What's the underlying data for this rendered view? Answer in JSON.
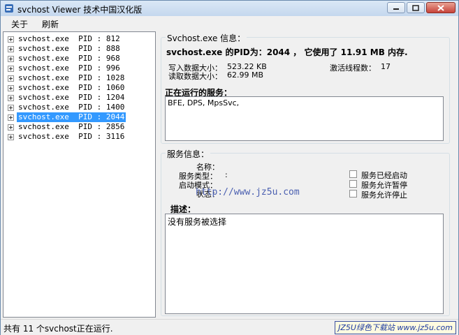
{
  "window": {
    "title": "svchost Viewer 技术中国汉化版"
  },
  "menu": {
    "items": [
      "关于",
      "刷新"
    ]
  },
  "tree": {
    "items": [
      {
        "name": "svchost.exe",
        "pid": "PID : 812",
        "selected": false
      },
      {
        "name": "svchost.exe",
        "pid": "PID : 888",
        "selected": false
      },
      {
        "name": "svchost.exe",
        "pid": "PID : 968",
        "selected": false
      },
      {
        "name": "svchost.exe",
        "pid": "PID : 996",
        "selected": false
      },
      {
        "name": "svchost.exe",
        "pid": "PID : 1028",
        "selected": false
      },
      {
        "name": "svchost.exe",
        "pid": "PID : 1060",
        "selected": false
      },
      {
        "name": "svchost.exe",
        "pid": "PID : 1204",
        "selected": false
      },
      {
        "name": "svchost.exe",
        "pid": "PID : 1400",
        "selected": false
      },
      {
        "name": "svchost.exe",
        "pid": "PID : 2044",
        "selected": true
      },
      {
        "name": "svchost.exe",
        "pid": "PID : 2856",
        "selected": false
      },
      {
        "name": "svchost.exe",
        "pid": "PID : 3116",
        "selected": false
      }
    ]
  },
  "info": {
    "group_title": "Svchost.exe 信息：",
    "summary": "svchost.exe 的PID为：2044 ， 它使用了 11.91 MB 内存.",
    "write_label": "写入数据大小：",
    "write_value": "523.22 KB",
    "read_label": "读取数据大小：",
    "read_value": "62.99 MB",
    "threads_label": "激活线程数：",
    "threads_value": "17",
    "running_label": "正在运行的服务：",
    "running_services": "BFE, DPS, MpsSvc,"
  },
  "service": {
    "group_title": "服务信息：",
    "name_label": "名称：",
    "type_label": "服务类型：",
    "type_value": ":",
    "start_label": "启动模式：",
    "status_label": "状态：",
    "chk_started": "服务已经启动",
    "chk_pause": "服务允许暂停",
    "chk_stop": "服务允许停止",
    "desc_label": "描述：",
    "desc_text": "没有服务被选择"
  },
  "status": {
    "text": "共有 11 个svchost正在运行.",
    "badge": "JZ5U绿色下载站 www.jz5u.com"
  },
  "watermark": {
    "url": "http://www.jz5u.com"
  }
}
